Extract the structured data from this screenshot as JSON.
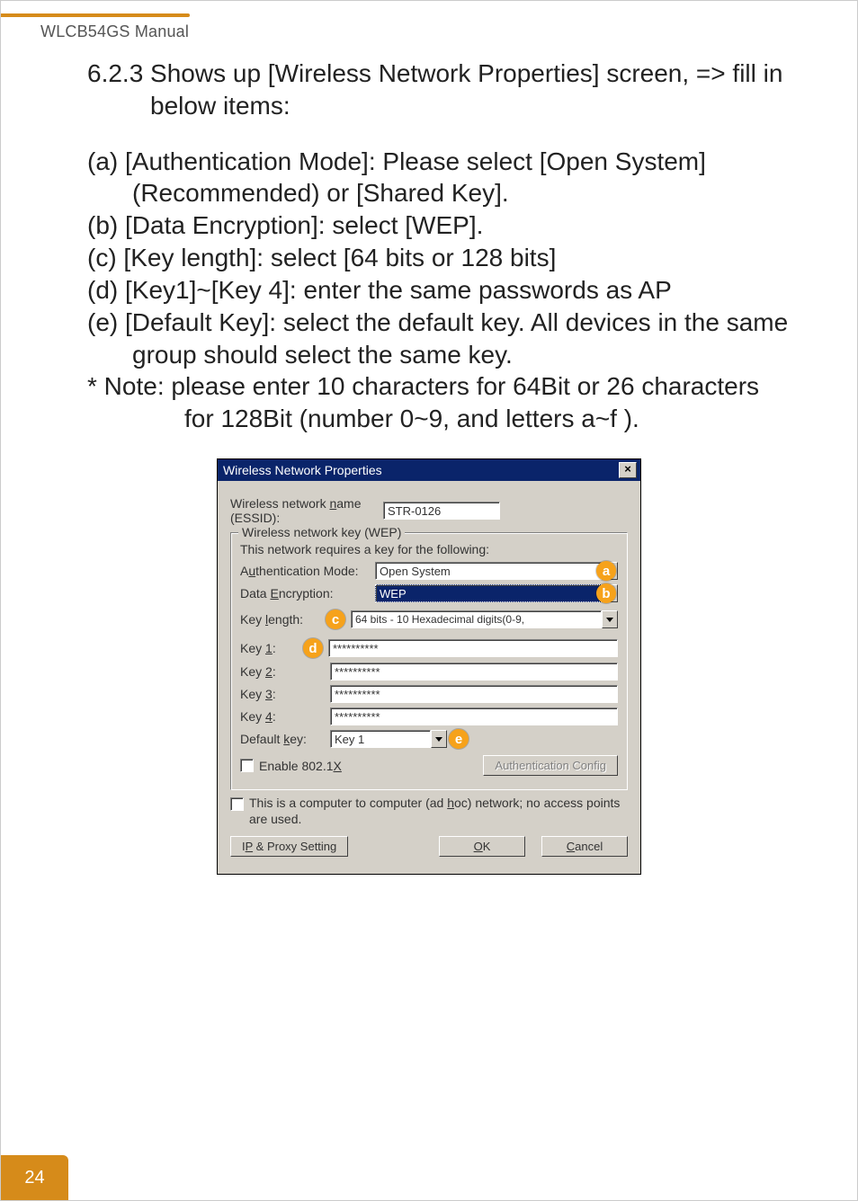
{
  "header": {
    "doc_title": "WLCB54GS Manual"
  },
  "text": {
    "section_heading": "6.2.3 Shows up [Wireless Network Properties] screen, => fill in below items:",
    "item_a": "(a) [Authentication Mode]: Please select [Open System] (Recommended) or [Shared Key].",
    "item_b": "(b) [Data Encryption]: select [WEP].",
    "item_c": "(c) [Key length]: select [64 bits or 128 bits]",
    "item_d": "(d) [Key1]~[Key 4]: enter the same passwords as AP",
    "item_e": "(e) [Default Key]: select the default key. All devices in the same group should select the same key.",
    "note_line1": "* Note: please enter 10 characters for 64Bit or 26 characters",
    "note_line2": "for 128Bit (number 0~9, and letters  a~f )."
  },
  "dialog": {
    "title": "Wireless Network Properties",
    "essid_label_pre": "Wireless network ",
    "essid_label_u": "n",
    "essid_label_post": "ame (ESSID):",
    "essid_value": "STR-0126",
    "group_legend": "Wireless network key (WEP)",
    "group_desc": "This network requires a key for the following:",
    "auth_label_pre": "A",
    "auth_label_u": "u",
    "auth_label_post": "thentication Mode:",
    "auth_value": "Open System",
    "enc_label_pre": "Data ",
    "enc_label_u": "E",
    "enc_label_post": "ncryption:",
    "enc_value": "WEP",
    "keylen_label_pre": "Key ",
    "keylen_label_u": "l",
    "keylen_label_post": "ength:",
    "keylen_value": "64 bits - 10 Hexadecimal digits(0-9,",
    "key1_label_pre": "Key ",
    "key1_label_u": "1",
    "key1_label_post": ":",
    "key2_label_pre": "Key ",
    "key2_label_u": "2",
    "key2_label_post": ":",
    "key3_label_pre": "Key ",
    "key3_label_u": "3",
    "key3_label_post": ":",
    "key4_label_pre": "Key ",
    "key4_label_u": "4",
    "key4_label_post": ":",
    "key_value": "**********",
    "defkey_label_pre": "Default ",
    "defkey_label_u": "k",
    "defkey_label_post": "ey:",
    "defkey_value": "Key 1",
    "enable8021x_pre": "Enable 802.1",
    "enable8021x_u": "X",
    "authcfg_btn": "Authentication Config",
    "adhoc_pre": "This is a computer to computer (ad ",
    "adhoc_u": "h",
    "adhoc_post": "oc) network; no access points are used.",
    "ipproxy_pre": "I",
    "ipproxy_u": "P",
    "ipproxy_post": " & Proxy Setting",
    "ok_u": "O",
    "ok_post": "K",
    "cancel_u": "C",
    "cancel_post": "ancel"
  },
  "badges": {
    "a": "a",
    "b": "b",
    "c": "c",
    "d": "d",
    "e": "e"
  },
  "footer": {
    "page": "24"
  }
}
